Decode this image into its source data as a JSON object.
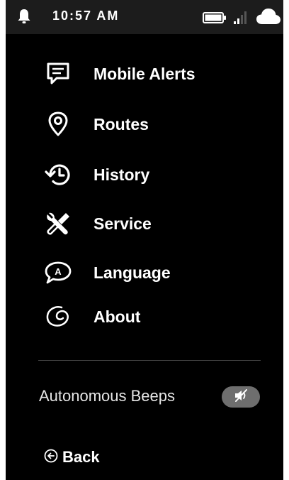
{
  "status_bar": {
    "time": "10:57 AM",
    "icons": [
      "bell-icon",
      "battery-icon",
      "signal-icon",
      "cloud-icon"
    ]
  },
  "menu": {
    "items": [
      {
        "label": "Mobile Alerts",
        "icon": "message-icon"
      },
      {
        "label": "Routes",
        "icon": "location-pin-icon"
      },
      {
        "label": "History",
        "icon": "history-icon"
      },
      {
        "label": "Service",
        "icon": "wrench-screwdriver-icon"
      },
      {
        "label": "Language",
        "icon": "speech-bubble-a-icon"
      },
      {
        "label": "About",
        "icon": "swirl-icon"
      }
    ]
  },
  "settings": {
    "autonomous_beeps_label": "Autonomous Beeps",
    "autonomous_beeps_state": "muted"
  },
  "back": {
    "label": "Back",
    "icon": "back-arrow-circle-icon"
  },
  "colors": {
    "background": "#000000",
    "status_bar": "#1c1c1c",
    "text": "#ffffff",
    "toggle": "#6e6e6e",
    "divider": "#4a4a4a"
  }
}
